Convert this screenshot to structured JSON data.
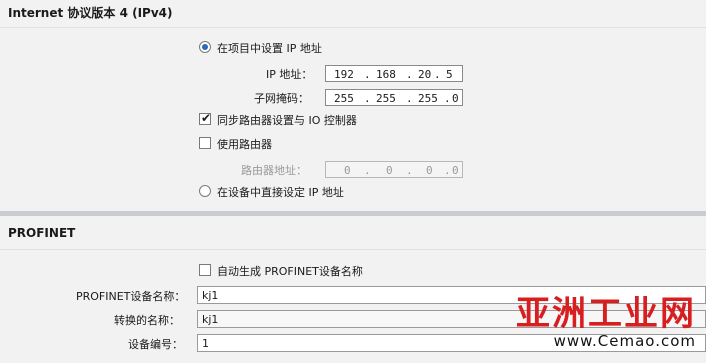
{
  "ipv4": {
    "title": "Internet 协议版本 4 (IPv4)",
    "radio_set_in_project": "在项目中设置 IP 地址",
    "ip_label": "IP 地址：",
    "ip_address": [
      "192",
      "168",
      "20",
      "5"
    ],
    "subnet_label": "子网掩码：",
    "subnet_mask": [
      "255",
      "255",
      "255",
      "0"
    ],
    "sync_router_label": "同步路由器设置与 IO 控制器",
    "use_router_label": "使用路由器",
    "router_addr_label": "路由器地址：",
    "router_address": [
      "0",
      "0",
      "0",
      "0"
    ],
    "radio_set_on_device": "在设备中直接设定 IP 地址",
    "set_in_project_selected": true,
    "sync_router_checked": true,
    "use_router_checked": false
  },
  "profinet": {
    "title": "PROFINET",
    "auto_generate_label": "自动生成 PROFINET设备名称",
    "auto_generate_checked": false,
    "device_name_label": "PROFINET设备名称：",
    "device_name": "kj1",
    "converted_name_label": "转换的名称：",
    "converted_name": "kj1",
    "device_number_label": "设备编号：",
    "device_number": "1"
  },
  "watermark": {
    "brand": "亚洲工业网",
    "url": "www.Cemao.com"
  },
  "colors": {
    "accent": "#2a6ab3",
    "watermark_red": "#d81e1e",
    "panel_bg": "#f2f2f2"
  }
}
